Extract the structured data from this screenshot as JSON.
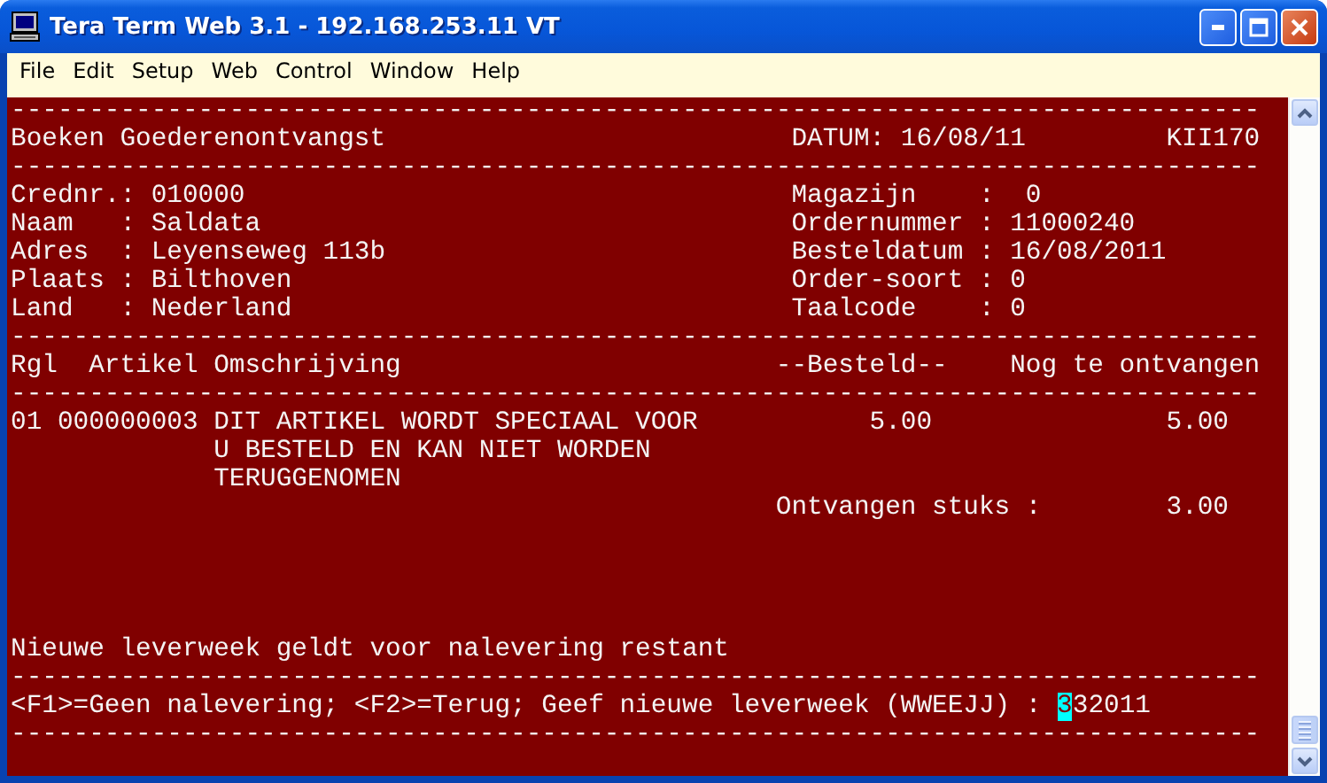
{
  "window": {
    "title": "Tera Term Web 3.1 - 192.168.253.11 VT"
  },
  "menu": [
    "File",
    "Edit",
    "Setup",
    "Web",
    "Control",
    "Window",
    "Help"
  ],
  "terminal": {
    "lines": [
      {
        "kind": "text",
        "text": "--------------------------------------------------------------------------------"
      },
      {
        "kind": "text",
        "text": "Boeken Goederenontvangst                          DATUM: 16/08/11         KII170"
      },
      {
        "kind": "text",
        "text": "--------------------------------------------------------------------------------"
      },
      {
        "kind": "text",
        "text": "Crednr.: 010000                                   Magazijn    :  0"
      },
      {
        "kind": "text",
        "text": "Naam   : Saldata                                  Ordernummer : 11000240"
      },
      {
        "kind": "text",
        "text": "Adres  : Leyenseweg 113b                          Besteldatum : 16/08/2011"
      },
      {
        "kind": "text",
        "text": "Plaats : Bilthoven                                Order-soort : 0"
      },
      {
        "kind": "text",
        "text": "Land   : Nederland                                Taalcode    : 0"
      },
      {
        "kind": "text",
        "text": "--------------------------------------------------------------------------------"
      },
      {
        "kind": "text",
        "text": "Rgl  Artikel Omschrijving                        --Besteld--    Nog te ontvangen"
      },
      {
        "kind": "text",
        "text": "--------------------------------------------------------------------------------"
      },
      {
        "kind": "text",
        "text": "01 000000003 DIT ARTIKEL WORDT SPECIAAL VOOR           5.00               5.00"
      },
      {
        "kind": "text",
        "text": "             U BESTELD EN KAN NIET WORDEN"
      },
      {
        "kind": "text",
        "text": "             TERUGGENOMEN"
      },
      {
        "kind": "text",
        "text": "                                                 Ontvangen stuks :        3.00"
      },
      {
        "kind": "blank"
      },
      {
        "kind": "blank"
      },
      {
        "kind": "blank"
      },
      {
        "kind": "blank"
      },
      {
        "kind": "text",
        "text": "Nieuwe leverweek geldt voor nalevering restant"
      },
      {
        "kind": "text",
        "text": "--------------------------------------------------------------------------------"
      },
      {
        "kind": "prompt",
        "text": "<F1>=Geen nalevering; <F2>=Terug; Geef nieuwe leverweek (WWEEJJ) : ",
        "cursor_text": "3",
        "rest_text": "32011"
      },
      {
        "kind": "text",
        "text": "--------------------------------------------------------------------------------"
      }
    ]
  }
}
